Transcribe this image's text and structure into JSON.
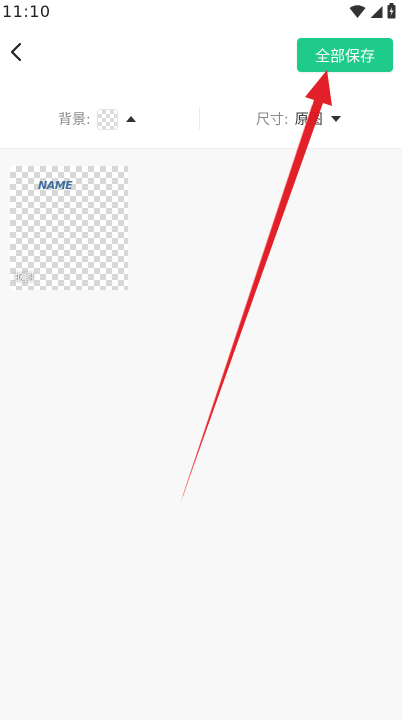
{
  "status_bar": {
    "time": "11:10",
    "icons": [
      "wifi-icon",
      "cellular-icon",
      "battery-icon"
    ]
  },
  "header": {
    "back_icon": "chevron-left-icon",
    "save_all_label": "全部保存",
    "accent_color": "#1ecb8a"
  },
  "toolbar": {
    "background_label": "背景:",
    "background_swatch": "transparent-checker",
    "size_label": "尺寸:",
    "size_value": "原图"
  },
  "content": {
    "thumbnail": {
      "art_text": "NAME",
      "caption": "抠图"
    }
  },
  "annotation": {
    "arrow_color": "#e0141e"
  }
}
